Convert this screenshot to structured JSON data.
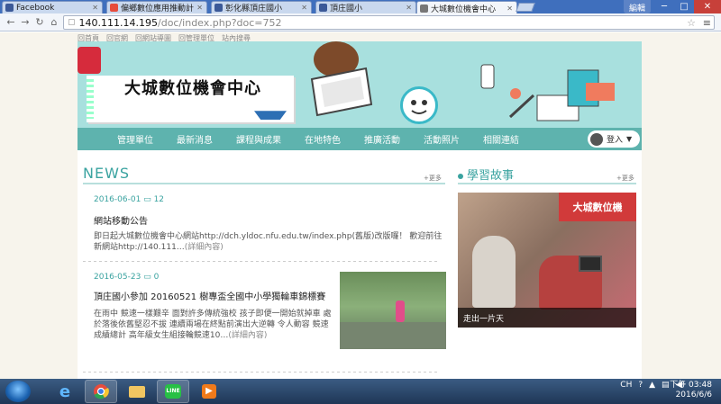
{
  "browser": {
    "tabs": [
      {
        "title": "Facebook",
        "color": "#3b5998"
      },
      {
        "title": "偏鄉數位應用推動計",
        "color": "#e74c3c"
      },
      {
        "title": "彰化縣頂庄國小",
        "color": "#3b5998"
      },
      {
        "title": "頂庄國小",
        "color": "#3b5998"
      },
      {
        "title": "大城數位機會中心",
        "color": "#777777",
        "active": true
      }
    ],
    "user_label": "編輯",
    "url_host": "140.111.14.195",
    "url_path": "/doc/index.php?doc=752"
  },
  "page": {
    "top_links": [
      "回首頁",
      "回官網",
      "回網站導圖",
      "回管理單位",
      "站內搜尋"
    ],
    "site_title": "大城數位機會中心",
    "nav": [
      "管理單位",
      "最新消息",
      "課程與成果",
      "在地特色",
      "推廣活動",
      "活動照片",
      "相關連結"
    ],
    "login_label": "登入",
    "news": {
      "heading": "NEWS",
      "more": "+更多",
      "items": [
        {
          "date": "2016-06-01",
          "count_icon": "comment-icon",
          "count": "12",
          "title": "網站移動公告",
          "excerpt": "即日起大城數位機會中心網站http://dch.yldoc.nfu.edu.tw/index.php(舊版)改版囉！ 歡迎前往新網站http://140.111…",
          "detail": "(詳細內容)"
        },
        {
          "date": "2016-05-23",
          "count": "0",
          "title": "頂庄國小參加 20160521 樹專盃全國中小學獨輪車錦標賽",
          "excerpt": "在雨中 競速一樣艱辛 面對許多傳統強校 孩子即便一開始就掉車 處於落後依舊堅忍不拔 連續兩場在終點前演出大逆轉 令人動容 競速成績總計 高年級女生組接輪競速10…",
          "detail": "(詳細內容)"
        }
      ],
      "third_date_partial": "2016-05-23"
    },
    "story": {
      "heading": "學習故事",
      "more": "+更多",
      "sign_text": "大城數位機",
      "caption": "走出一片天"
    }
  },
  "taskbar": {
    "apps": [
      "windows-start",
      "internet-explorer",
      "chrome",
      "file-explorer",
      "line",
      "media-player"
    ],
    "lang": "CH",
    "time": "下午 03:48",
    "date": "2016/6/6"
  }
}
